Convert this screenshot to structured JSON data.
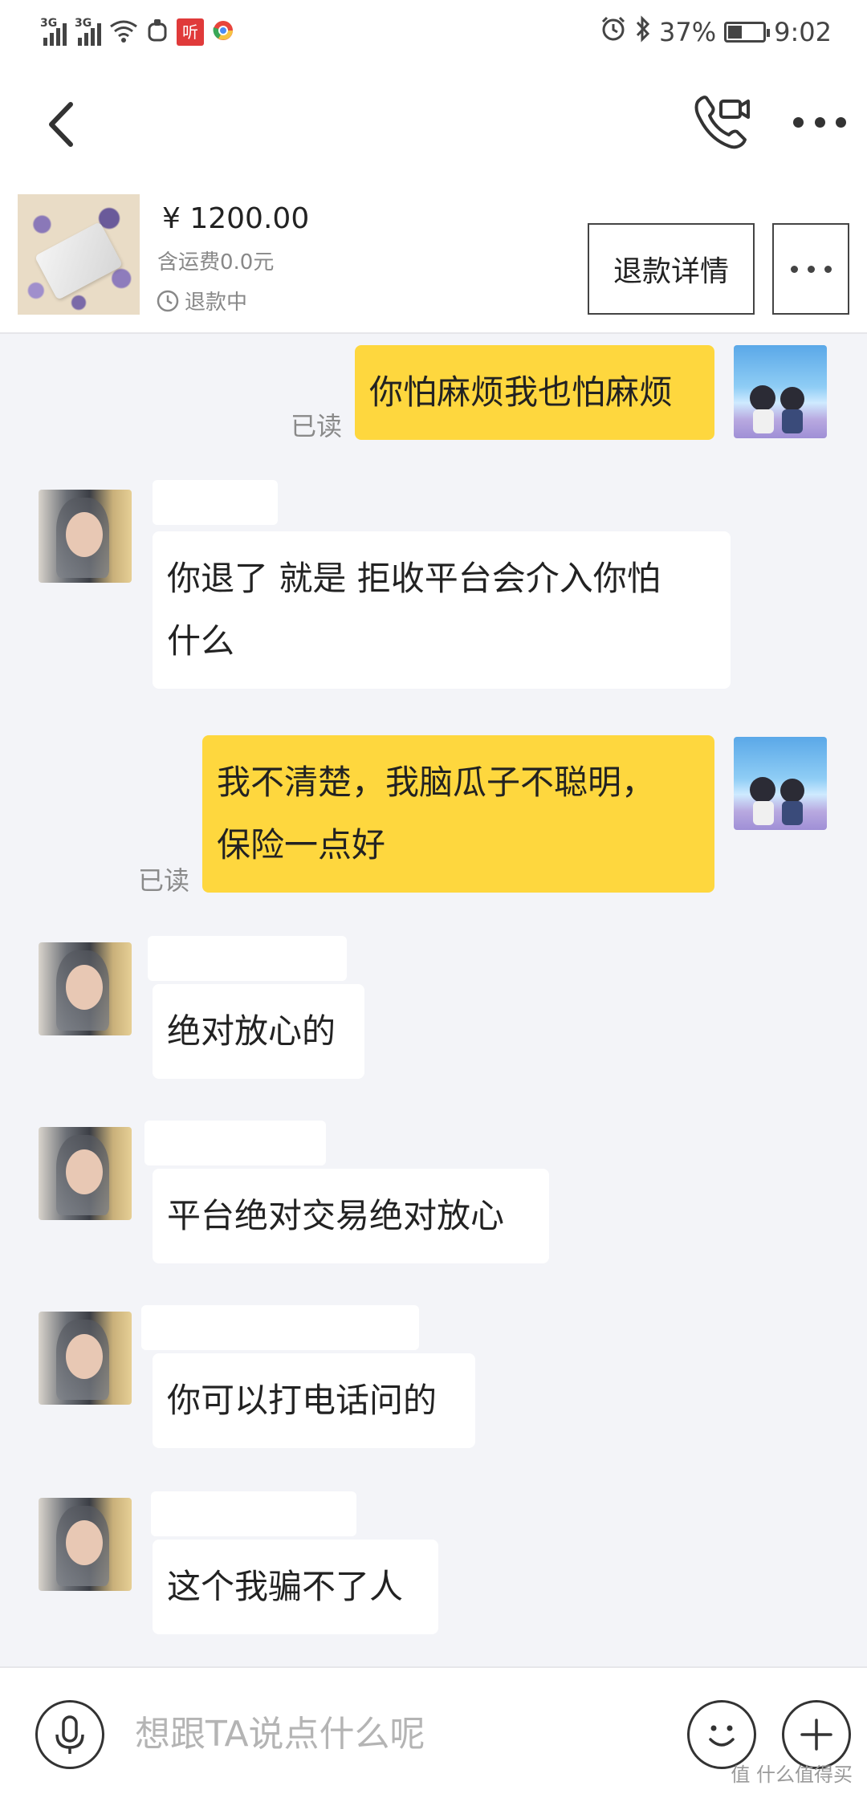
{
  "status_bar": {
    "network_1": "3G",
    "network_2": "3G",
    "app_badge": "听",
    "battery_text": "37%",
    "battery_level": 0.37,
    "time": "9:02"
  },
  "nav_bar": {
    "back_icon": "chevron-left-icon",
    "call_icon": "video-call-icon",
    "more_icon": "more-horizontal-icon"
  },
  "product": {
    "price": "¥ 1200.00",
    "shipping": "含运费0.0元",
    "status": "退款中",
    "refund_detail_label": "退款详情"
  },
  "messages": [
    {
      "side": "out",
      "text": "你怕麻烦我也怕麻烦",
      "read": "已读"
    },
    {
      "side": "in",
      "text_lines": [
        "你退了 就是 拒收平台会介入你怕",
        "什么"
      ]
    },
    {
      "side": "out",
      "text_lines": [
        "我不清楚，我脑瓜子不聪明，",
        "保险一点好"
      ],
      "read": "已读"
    },
    {
      "side": "in",
      "text": "绝对放心的"
    },
    {
      "side": "in",
      "text": "平台绝对交易绝对放心"
    },
    {
      "side": "in",
      "text": "你可以打电话问的"
    },
    {
      "side": "in",
      "text": "这个我骗不了人"
    }
  ],
  "input_bar": {
    "placeholder": "想跟TA说点什么呢",
    "mic_icon": "microphone-icon",
    "emoji_icon": "smiley-icon",
    "add_icon": "plus-icon"
  },
  "watermark": "值 什么值得买"
}
